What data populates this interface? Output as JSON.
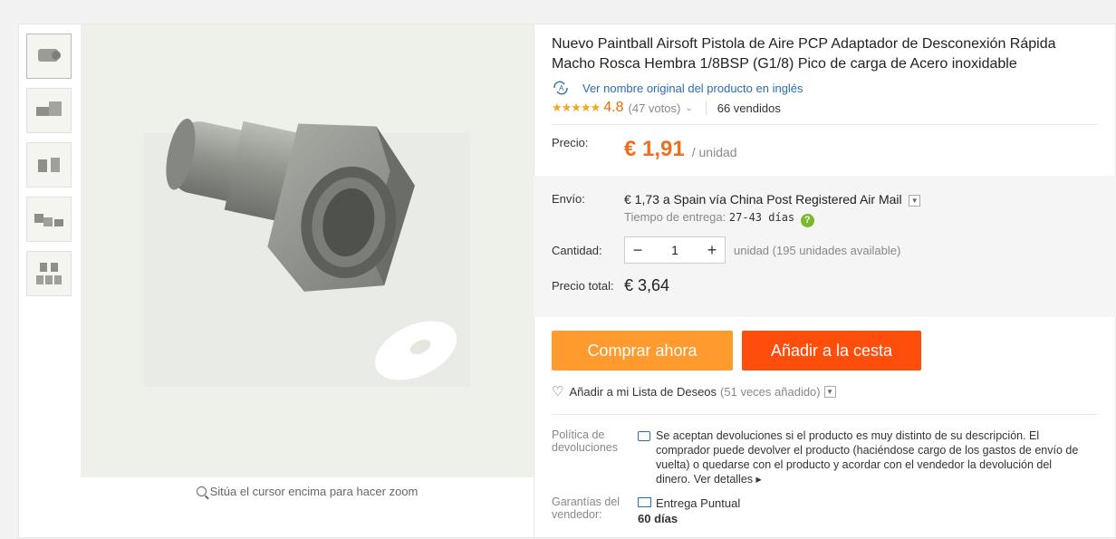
{
  "gallery": {
    "thumbs": [
      "thumbnail-1",
      "thumbnail-2",
      "thumbnail-3",
      "thumbnail-4",
      "thumbnail-5"
    ],
    "zoom_hint": "Sitúa el cursor encima para hacer zoom"
  },
  "product": {
    "title": "Nuevo Paintball Airsoft Pistola de Aire PCP Adaptador de Desconexión Rápida Macho Rosca Hembra 1/8BSP (G1/8) Pico de carga de Acero inoxidable",
    "original_link": "Ver nombre original del producto en inglés",
    "stars": "★★★★★",
    "rating": "4.8",
    "votes": "(47 votos)",
    "sold": "66 vendidos"
  },
  "price": {
    "label": "Precio:",
    "value": "€ 1,91",
    "unit": "/ unidad"
  },
  "shipping": {
    "label": "Envío:",
    "value": "€ 1,73 a Spain vía China Post Registered Air Mail",
    "delivery_label": "Tiempo de entrega:",
    "delivery_days": "27-43 días"
  },
  "quantity": {
    "label": "Cantidad:",
    "value": "1",
    "minus": "−",
    "plus": "+",
    "availability": "unidad (195 unidades available)"
  },
  "total": {
    "label": "Precio total:",
    "value": "€ 3,64"
  },
  "actions": {
    "buy_now": "Comprar ahora",
    "add_to_cart": "Añadir a la cesta",
    "wishlist": "Añadir a mi Lista de Deseos",
    "wishlist_count": "(51 veces añadido)"
  },
  "policy": {
    "label": "Política de devoluciones",
    "text": "Se aceptan devoluciones si el producto es muy distinto de su descripción. El comprador puede devolver el producto (haciéndose cargo de los gastos de envío de vuelta) o quedarse con el producto y acordar con el vendedor la devolución del dinero.",
    "more": "Ver detalles ▸"
  },
  "guarantee": {
    "label": "Garantías del vendedor:",
    "title": "Entrega Puntual",
    "days": "60 días"
  },
  "colors": {
    "accent_price": "#f26d21",
    "buy_button": "#ff9a2e",
    "cart_button": "#ff4d0c",
    "link": "#2a6cb6",
    "star": "#f5a623"
  }
}
